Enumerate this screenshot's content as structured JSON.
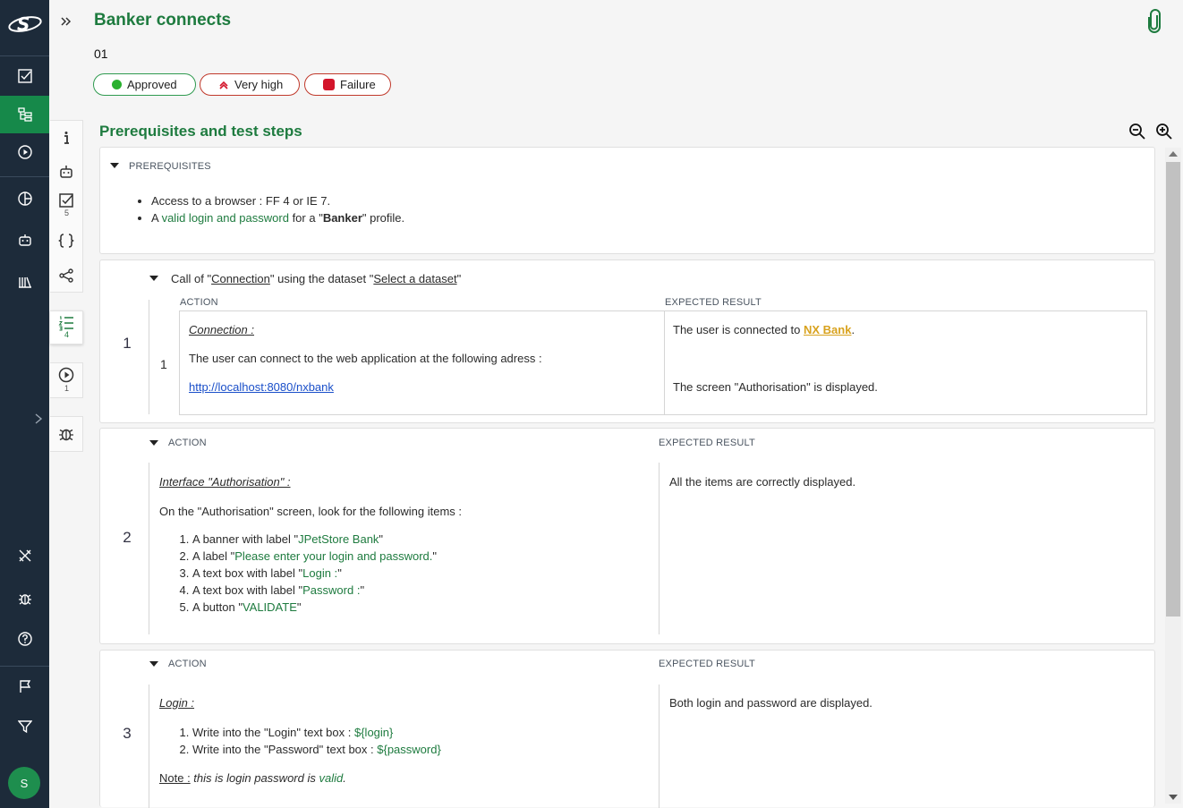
{
  "header": {
    "title": "Banker connects",
    "reference": "01",
    "status": "Approved",
    "importance": "Very high",
    "execution": "Failure"
  },
  "colors": {
    "brand": "#1e7b3f",
    "nav_bg": "#1d2b3a",
    "nav_active": "#16894a",
    "approved": "#29b02e",
    "failure": "#d3152b",
    "link": "#1a4fc9",
    "highlight": "#d8a21e"
  },
  "tool_counts": {
    "requirements": "5",
    "steps": "4",
    "executions": "1"
  },
  "section": {
    "title": "Prerequisites and test steps"
  },
  "prerequisites": {
    "label": "PREREQUISITES",
    "item1": "Access to a browser : FF 4 or IE 7.",
    "item2_pre": "A ",
    "item2_green": "valid login and password",
    "item2_mid": " for a \"",
    "item2_bold": "Banker",
    "item2_post": "\" profile."
  },
  "columns": {
    "action": "ACTION",
    "expected": "EXPECTED RESULT"
  },
  "step1": {
    "number": "1",
    "call_pre": "Call of \"",
    "call_link": "Connection",
    "call_mid": "\" using the dataset \"",
    "call_dataset": "Select a dataset",
    "call_post": "\"",
    "sub_number": "1",
    "action_title": "Connection :",
    "action_text": "The user can connect to the web application at the following adress :",
    "action_link": "http://localhost:8080/nxbank",
    "expected_pre": "The user is connected to ",
    "expected_bank": "NX Bank",
    "expected_post": ".",
    "expected_line2": "The screen \"Authorisation\" is displayed."
  },
  "step2": {
    "number": "2",
    "action_title": "Interface \"Authorisation\" :",
    "action_text": "On the \"Authorisation\" screen, look for the following items :",
    "items": [
      {
        "pre": "A banner with label \"",
        "val": "JPetStore Bank",
        "post": "\""
      },
      {
        "pre": "A label \"",
        "val": "Please enter your login and password.",
        "post": "\""
      },
      {
        "pre": "A text box with label \"",
        "val": "Login :",
        "post": "\""
      },
      {
        "pre": "A text box with label \"",
        "val": "Password :",
        "post": "\""
      },
      {
        "pre": "A button \"",
        "val": "VALIDATE",
        "post": "\""
      }
    ],
    "expected": "All the items are correctly displayed."
  },
  "step3": {
    "number": "3",
    "action_title": "Login :",
    "items": [
      {
        "pre": "Write into the \"Login\" text box : ",
        "val": "${login}"
      },
      {
        "pre": "Write into the \"Password\" text box : ",
        "val": "${password}"
      }
    ],
    "note_label": "Note :",
    "note_text": " this is login password is ",
    "note_green": "valid",
    "note_end": ".",
    "expected": "Both login and password are displayed."
  },
  "user": {
    "initial": "S"
  }
}
